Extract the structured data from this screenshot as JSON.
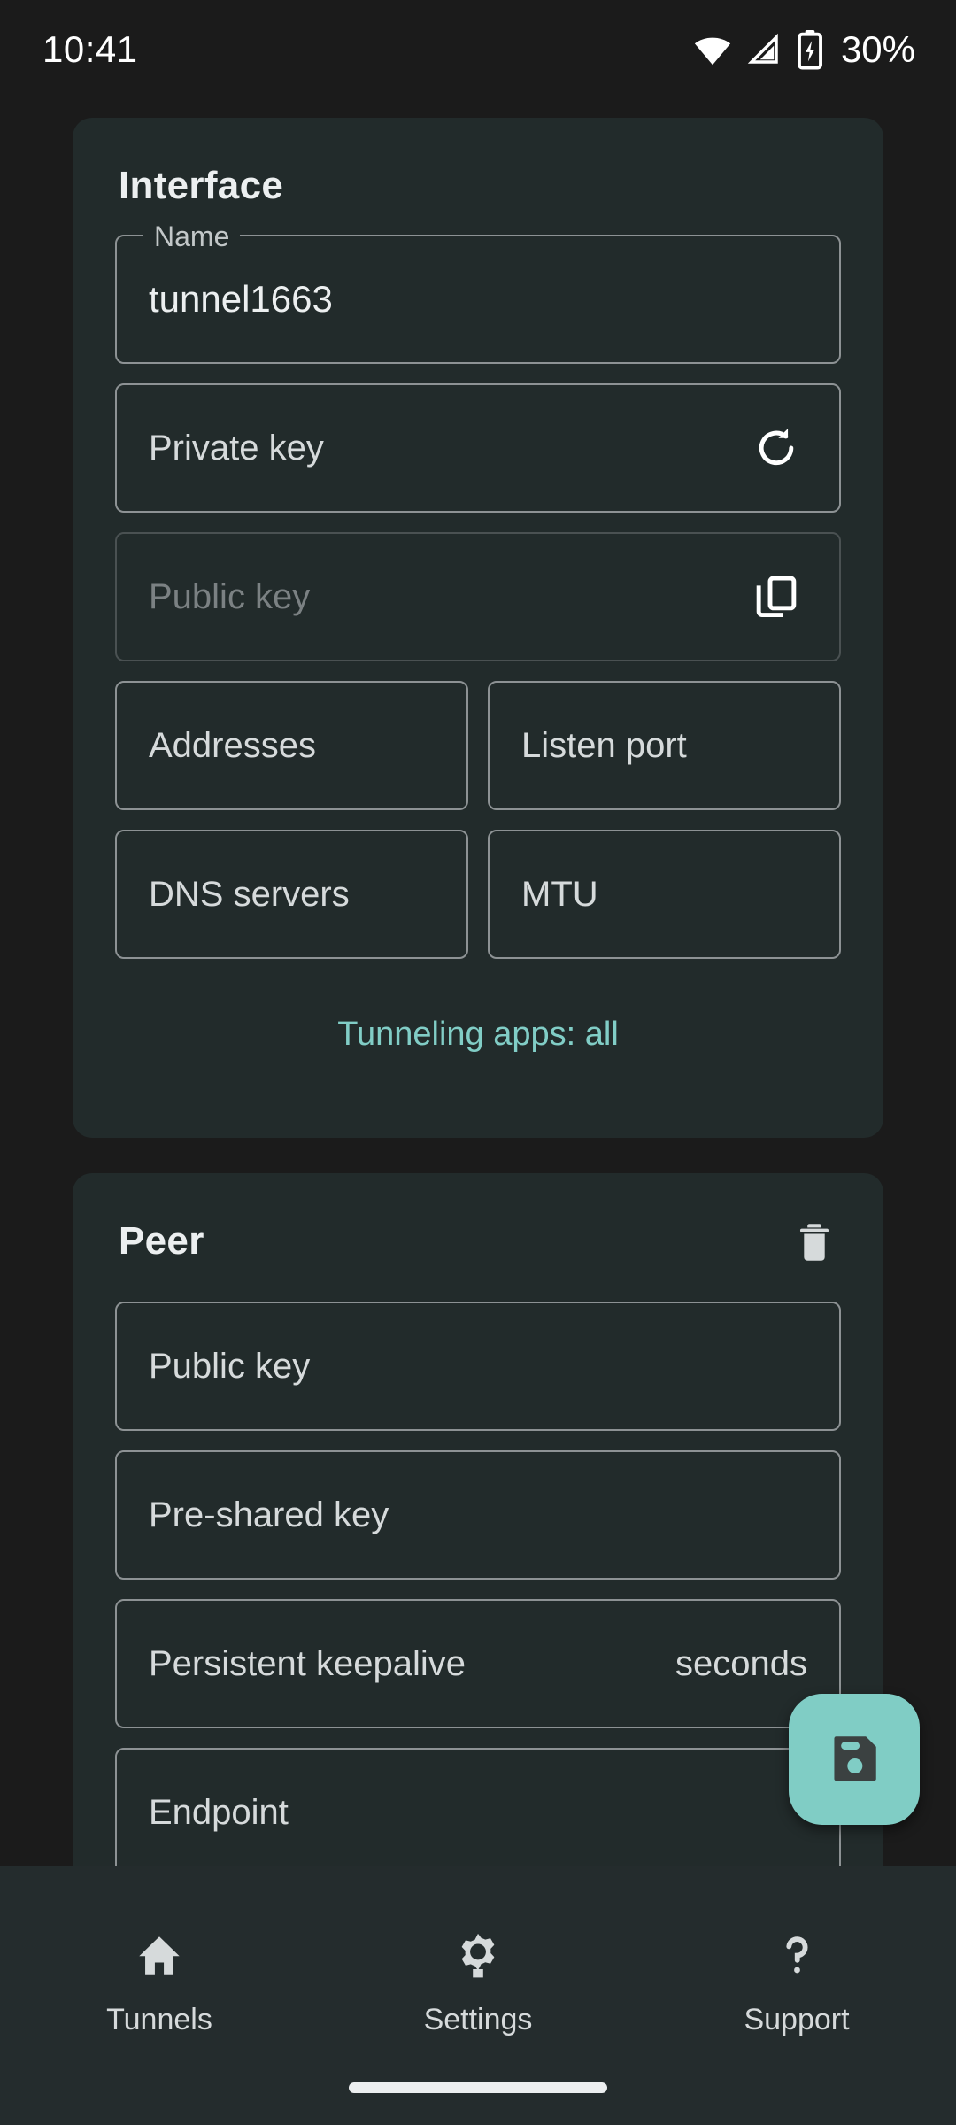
{
  "status_bar": {
    "time": "10:41",
    "battery_percent": "30%",
    "icons": [
      "wifi-icon",
      "cellular-signal-icon",
      "battery-charging-icon"
    ]
  },
  "interface": {
    "title": "Interface",
    "name_field": {
      "label": "Name",
      "value": "tunnel1663"
    },
    "private_key": {
      "label": "Private key",
      "trailing_icon": "refresh-icon"
    },
    "public_key": {
      "label": "Public key",
      "trailing_icon": "copy-icon",
      "disabled": true
    },
    "addresses": {
      "label": "Addresses"
    },
    "listen_port": {
      "label": "Listen port"
    },
    "dns_servers": {
      "label": "DNS servers"
    },
    "mtu": {
      "label": "MTU"
    },
    "tunneling_apps": {
      "label": "Tunneling apps: all",
      "color": "#81cdc6"
    }
  },
  "peer": {
    "title": "Peer",
    "delete_icon": "trash-icon",
    "public_key": {
      "label": "Public key"
    },
    "pre_shared_key": {
      "label": "Pre-shared key"
    },
    "persistent_keepalive": {
      "label": "Persistent keepalive",
      "suffix": "seconds"
    },
    "endpoint": {
      "label": "Endpoint"
    }
  },
  "fab": {
    "icon": "save-icon",
    "color": "#80cdc5"
  },
  "bottom_nav": {
    "items": [
      {
        "label": "Tunnels",
        "icon": "home-icon"
      },
      {
        "label": "Settings",
        "icon": "gear-icon"
      },
      {
        "label": "Support",
        "icon": "question-mark-icon"
      }
    ]
  },
  "theme": {
    "page_background": "#1b1b1b",
    "card_background": "#222b2b",
    "nav_background": "#242c2d",
    "accent": "#80cdc5",
    "field_border": "#8d9294",
    "text_primary": "#eceff0",
    "text_secondary": "#d6dadb",
    "text_disabled": "#7b8183"
  }
}
